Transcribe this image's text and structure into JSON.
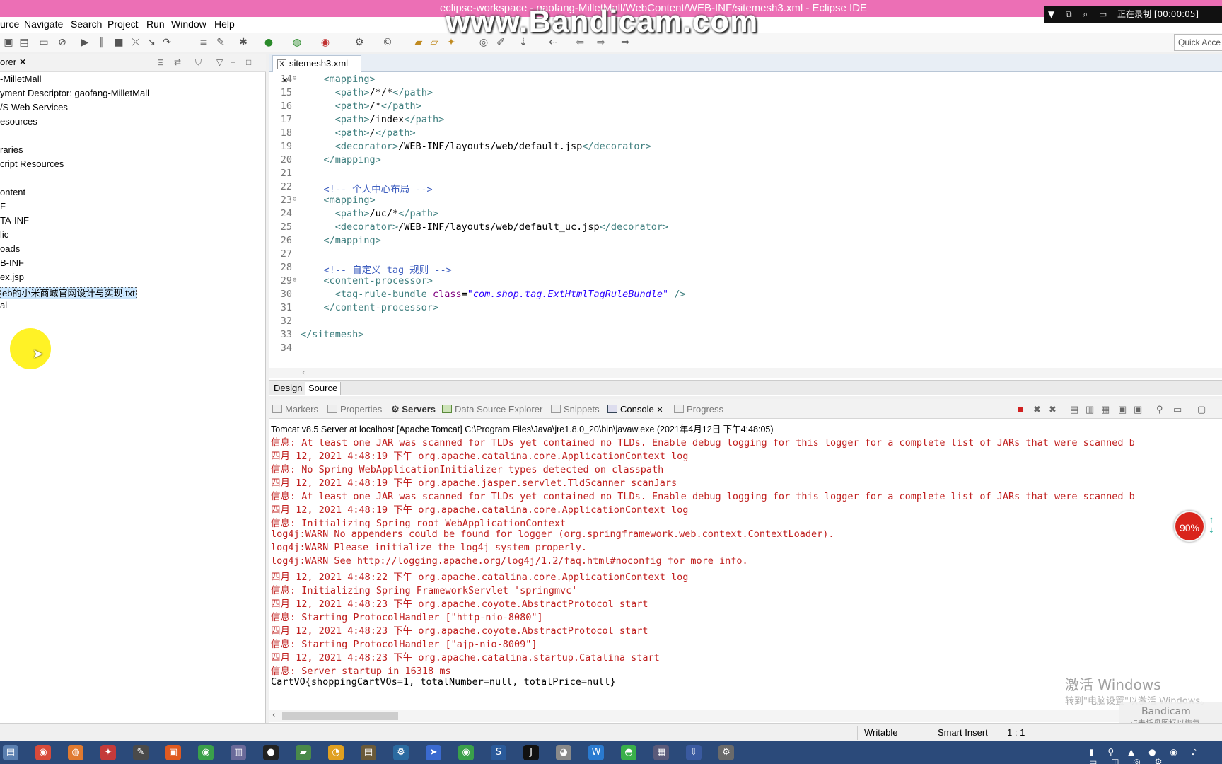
{
  "window": {
    "title": "eclipse-workspace - gaofang-MilletMall/WebContent/WEB-INF/sitemesh3.xml - Eclipse IDE",
    "watermark": "www.Bandicam.com",
    "recording_status": "正在录制 [00:00:05]"
  },
  "menu": [
    "urce",
    "Navigate",
    "Search",
    "Project",
    "Run",
    "Window",
    "Help"
  ],
  "toolbar": {
    "quick_access": "Quick Acce"
  },
  "explorer": {
    "tab_label": "orer",
    "items": [
      "-MilletMall",
      "yment Descriptor: gaofang-MilletMall",
      "/S Web Services",
      "esources",
      "",
      "raries",
      "cript Resources",
      "",
      "ontent",
      "F",
      "TA-INF",
      "lic",
      "oads",
      "B-INF",
      "ex.jsp",
      "eb的小米商城官网设计与实现.txt",
      "al"
    ],
    "selected_index": 15
  },
  "editor": {
    "tab_label": "sitemesh3.xml",
    "lines": [
      {
        "n": "14",
        "fold": true,
        "parts": [
          [
            "tag",
            "    <mapping>"
          ]
        ]
      },
      {
        "n": "15",
        "fold": false,
        "parts": [
          [
            "tag",
            "      <path>"
          ],
          [
            "txt",
            "/*/*"
          ],
          [
            "tag",
            "</path>"
          ]
        ]
      },
      {
        "n": "16",
        "fold": false,
        "parts": [
          [
            "tag",
            "      <path>"
          ],
          [
            "txt",
            "/*"
          ],
          [
            "tag",
            "</path>"
          ]
        ]
      },
      {
        "n": "17",
        "fold": false,
        "parts": [
          [
            "tag",
            "      <path>"
          ],
          [
            "txt",
            "/index"
          ],
          [
            "tag",
            "</path>"
          ]
        ]
      },
      {
        "n": "18",
        "fold": false,
        "parts": [
          [
            "tag",
            "      <path>"
          ],
          [
            "txt",
            "/"
          ],
          [
            "tag",
            "</path>"
          ]
        ]
      },
      {
        "n": "19",
        "fold": false,
        "parts": [
          [
            "tag",
            "      <decorator>"
          ],
          [
            "txt",
            "/WEB-INF/layouts/web/default.jsp"
          ],
          [
            "tag",
            "</decorator>"
          ]
        ]
      },
      {
        "n": "20",
        "fold": false,
        "parts": [
          [
            "tag",
            "    </mapping>"
          ]
        ]
      },
      {
        "n": "21",
        "fold": false,
        "parts": []
      },
      {
        "n": "22",
        "fold": false,
        "parts": [
          [
            "cmt",
            "    <!-- 个人中心布局 -->"
          ]
        ]
      },
      {
        "n": "23",
        "fold": true,
        "parts": [
          [
            "tag",
            "    <mapping>"
          ]
        ]
      },
      {
        "n": "24",
        "fold": false,
        "parts": [
          [
            "tag",
            "      <path>"
          ],
          [
            "txt",
            "/uc/*"
          ],
          [
            "tag",
            "</path>"
          ]
        ]
      },
      {
        "n": "25",
        "fold": false,
        "parts": [
          [
            "tag",
            "      <decorator>"
          ],
          [
            "txt",
            "/WEB-INF/layouts/web/default_uc.jsp"
          ],
          [
            "tag",
            "</decorator>"
          ]
        ]
      },
      {
        "n": "26",
        "fold": false,
        "parts": [
          [
            "tag",
            "    </mapping>"
          ]
        ]
      },
      {
        "n": "27",
        "fold": false,
        "parts": []
      },
      {
        "n": "28",
        "fold": false,
        "parts": [
          [
            "cmt",
            "    <!-- 自定义 tag 规则 -->"
          ]
        ]
      },
      {
        "n": "29",
        "fold": true,
        "parts": [
          [
            "tag",
            "    <content-processor>"
          ]
        ]
      },
      {
        "n": "30",
        "fold": false,
        "parts": [
          [
            "tag",
            "      <tag-rule-bundle "
          ],
          [
            "attr",
            "class"
          ],
          [
            "txt",
            "="
          ],
          [
            "val",
            "\"com.shop.tag.ExtHtmlTagRuleBundle\""
          ],
          [
            "tag",
            " />"
          ]
        ]
      },
      {
        "n": "31",
        "fold": false,
        "parts": [
          [
            "tag",
            "    </content-processor>"
          ]
        ]
      },
      {
        "n": "32",
        "fold": false,
        "parts": []
      },
      {
        "n": "33",
        "fold": false,
        "parts": [
          [
            "tag",
            "</sitemesh>"
          ]
        ]
      },
      {
        "n": "34",
        "fold": false,
        "parts": []
      }
    ],
    "modes": [
      "Design",
      "Source"
    ],
    "active_mode": "Source"
  },
  "panel": {
    "tabs": [
      "Markers",
      "Properties",
      "Servers",
      "Data Source Explorer",
      "Snippets",
      "Console",
      "Progress"
    ],
    "active_tab": "Console",
    "console_label": "Tomcat v8.5 Server at localhost [Apache Tomcat] C:\\Program Files\\Java\\jre1.8.0_20\\bin\\javaw.exe (2021年4月12日 下午4:48:05)",
    "lines": [
      {
        "text": "信息: At least one JAR was scanned for TLDs yet contained no TLDs. Enable debug logging for this logger for a complete list of JARs that were scanned b",
        "black": false
      },
      {
        "text": "四月 12, 2021 4:48:19 下午 org.apache.catalina.core.ApplicationContext log",
        "black": false
      },
      {
        "text": "信息: No Spring WebApplicationInitializer types detected on classpath",
        "black": false
      },
      {
        "text": "四月 12, 2021 4:48:19 下午 org.apache.jasper.servlet.TldScanner scanJars",
        "black": false
      },
      {
        "text": "信息: At least one JAR was scanned for TLDs yet contained no TLDs. Enable debug logging for this logger for a complete list of JARs that were scanned b",
        "black": false
      },
      {
        "text": "四月 12, 2021 4:48:19 下午 org.apache.catalina.core.ApplicationContext log",
        "black": false
      },
      {
        "text": "信息: Initializing Spring root WebApplicationContext",
        "black": false
      },
      {
        "text": "log4j:WARN No appenders could be found for logger (org.springframework.web.context.ContextLoader).",
        "black": false
      },
      {
        "text": "log4j:WARN Please initialize the log4j system properly.",
        "black": false
      },
      {
        "text": "log4j:WARN See http://logging.apache.org/log4j/1.2/faq.html#noconfig for more info.",
        "black": false
      },
      {
        "text": "四月 12, 2021 4:48:22 下午 org.apache.catalina.core.ApplicationContext log",
        "black": false
      },
      {
        "text": "信息: Initializing Spring FrameworkServlet 'springmvc'",
        "black": false
      },
      {
        "text": "四月 12, 2021 4:48:23 下午 org.apache.coyote.AbstractProtocol start",
        "black": false
      },
      {
        "text": "信息: Starting ProtocolHandler [\"http-nio-8080\"]",
        "black": false
      },
      {
        "text": "四月 12, 2021 4:48:23 下午 org.apache.coyote.AbstractProtocol start",
        "black": false
      },
      {
        "text": "信息: Starting ProtocolHandler [\"ajp-nio-8009\"]",
        "black": false
      },
      {
        "text": "四月 12, 2021 4:48:23 下午 org.apache.catalina.startup.Catalina start",
        "black": false
      },
      {
        "text": "信息: Server startup in 16318 ms",
        "black": false
      },
      {
        "text": "CartVO{shoppingCartVOs=1, totalNumber=null, totalPrice=null}",
        "black": true
      }
    ]
  },
  "progress_badge": "90%",
  "watermarks": {
    "windows_title": "激活 Windows",
    "windows_sub": "转到\"电脑设置\"以激活 Windows。",
    "bandicam_tip": "Bandicam",
    "bandicam_tip_sub": "点击托盘图标以恢复"
  },
  "statusbar": {
    "mode": "Writable",
    "insert": "Smart Insert",
    "position": "1 : 1"
  }
}
